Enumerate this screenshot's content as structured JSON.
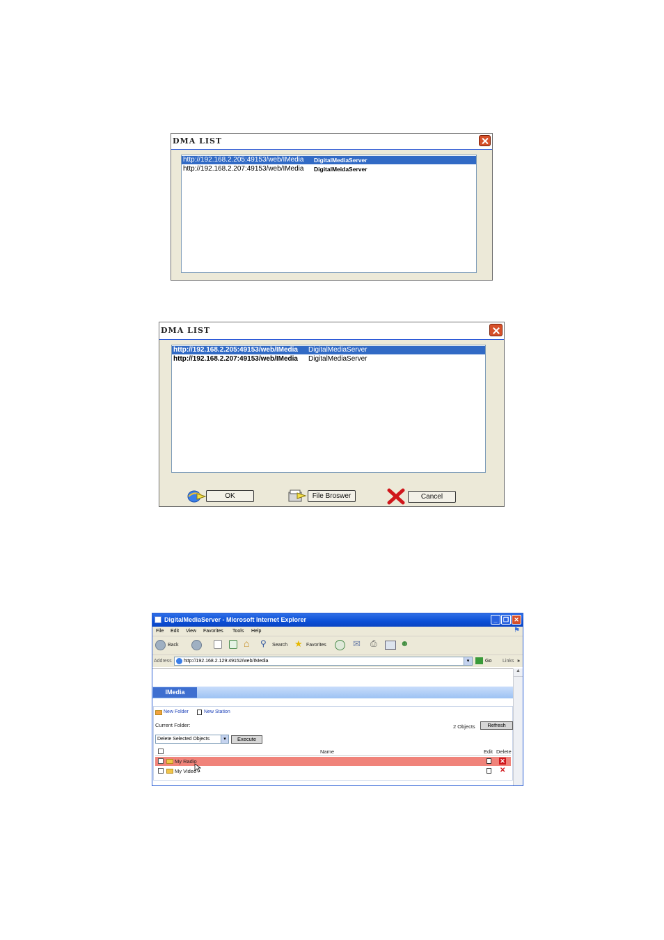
{
  "dialog1": {
    "title": "DMA LIST",
    "items": [
      {
        "url": "http://192.168.2.205:49153/web/IMedia",
        "name": "DigitalMediaServer",
        "selected": true
      },
      {
        "url": "http://192.168.2.207:49153/web/IMedia",
        "name": "DigitalMeidaServer",
        "selected": false
      }
    ]
  },
  "dialog2": {
    "title": "DMA LIST",
    "items": [
      {
        "url": "http://192.168.2.205:49153/web/IMedia",
        "name": "DigitalMediaServer",
        "selected": true
      },
      {
        "url": "http://192.168.2.207:49153/web/IMedia",
        "name": "DigitalMediaServer",
        "selected": false
      }
    ],
    "buttons": {
      "ok": "OK",
      "file_browser": "File Broswer",
      "cancel": "Cancel"
    }
  },
  "browser": {
    "title": "DigitalMediaServer - Microsoft Internet Explorer",
    "menu": [
      "File",
      "Edit",
      "View",
      "Favorites",
      "Tools",
      "Help"
    ],
    "toolbar": {
      "back": "Back",
      "search": "Search",
      "favorites": "Favorites"
    },
    "address_label": "Address",
    "address": "http://192.168.2.129:49152/web/IMedia",
    "go": "Go",
    "links": "Links",
    "tab": "IMedia",
    "new_folder": "New Folder",
    "new_station": "New Station",
    "current_folder_label": "Current Folder:",
    "objects_count": "2 Objects",
    "refresh": "Refresh",
    "action_select": "Delete Selected Objects",
    "execute": "Execute",
    "columns": {
      "name": "Name",
      "edit": "Edit",
      "delete": "Delete"
    },
    "rows": [
      {
        "name": "My Radio",
        "highlighted": true
      },
      {
        "name": "My Video",
        "highlighted": false
      }
    ]
  },
  "colors": {
    "selection": "#316ac5",
    "row_highlight": "#f0837a",
    "tab": "#3e6fd0",
    "title_blue": "#0b4fd6"
  }
}
